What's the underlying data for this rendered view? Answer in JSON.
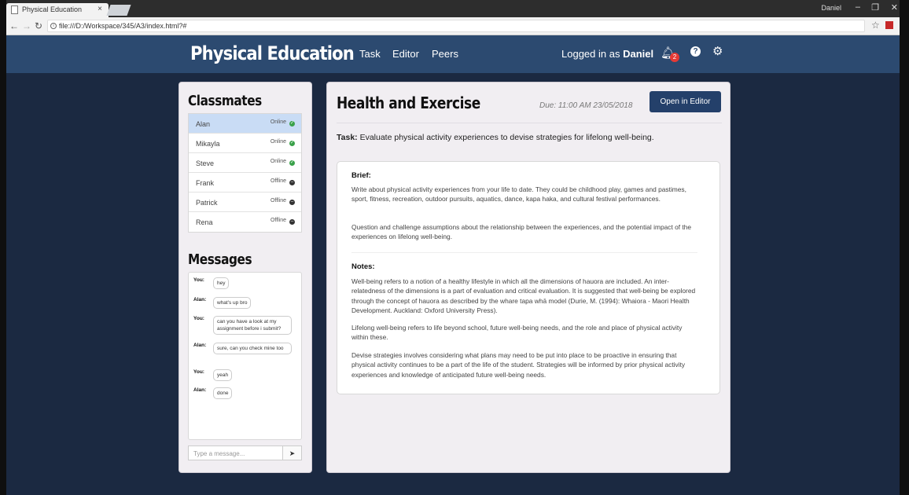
{
  "browser": {
    "tab_title": "Physical Education",
    "tab_close": "×",
    "window_user": "Daniel",
    "url": "file:///D:/Workspace/345/A3/index.html?#"
  },
  "nav": {
    "brand": "Physical Education",
    "links": [
      "Task",
      "Editor",
      "Peers"
    ],
    "logged_in_prefix": "Logged in as ",
    "username": "Daniel",
    "notifications_count": "2"
  },
  "classmates": {
    "title": "Classmates",
    "items": [
      {
        "name": "Alan",
        "status": "Online"
      },
      {
        "name": "Mikayla",
        "status": "Online"
      },
      {
        "name": "Steve",
        "status": "Online"
      },
      {
        "name": "Frank",
        "status": "Offline"
      },
      {
        "name": "Patrick",
        "status": "Offline"
      },
      {
        "name": "Rena",
        "status": "Offline"
      }
    ]
  },
  "messages": {
    "title": "Messages",
    "items": [
      {
        "from": "You:",
        "text": "hey"
      },
      {
        "from": "Alan:",
        "text": "what's up bro"
      },
      {
        "from": "You:",
        "text": "can you have a look at my assignment before i submit?"
      },
      {
        "from": "Alan:",
        "text": "sure, can you check mine too"
      },
      {
        "from": "You:",
        "text": "yeah"
      },
      {
        "from": "Alan:",
        "text": "done"
      }
    ],
    "placeholder": "Type a message..."
  },
  "task": {
    "title": "Health and Exercise",
    "due": "Due: 11:00 AM 23/05/2018",
    "open_button": "Open in Editor",
    "task_label": "Task:",
    "task_text": " Evaluate physical activity experiences to devise strategies for lifelong well-being.",
    "brief_heading": "Brief:",
    "brief_paragraphs": [
      "Write about physical activity experiences from your life to date. They could be childhood play, games and pastimes, sport, fitness, recreation, outdoor pursuits, aquatics, dance, kapa haka, and cultural festival performances.",
      "Question and challenge assumptions about the relationship between the experiences, and the potential impact of the experiences on lifelong well-being."
    ],
    "notes_heading": "Notes:",
    "notes_paragraphs": [
      "Well-being refers to a notion of a healthy lifestyle in which all the dimensions of hauora are included. An inter-relatedness of the dimensions is a part of evaluation and critical evaluation. It is suggested that well-being be explored through the concept of hauora as described by the whare tapa whā model (Durie, M. (1994): Whaiora - Maori Health Development. Auckland: Oxford University Press).",
      "Lifelong well-being refers to life beyond school, future well-being needs, and the role and place of physical activity within these.",
      "Devise strategies involves considering what plans may need to be put into place to be proactive in ensuring that physical activity continues to be a part of the life of the student. Strategies will be informed by prior physical activity experiences and knowledge of anticipated future well-being needs."
    ]
  }
}
